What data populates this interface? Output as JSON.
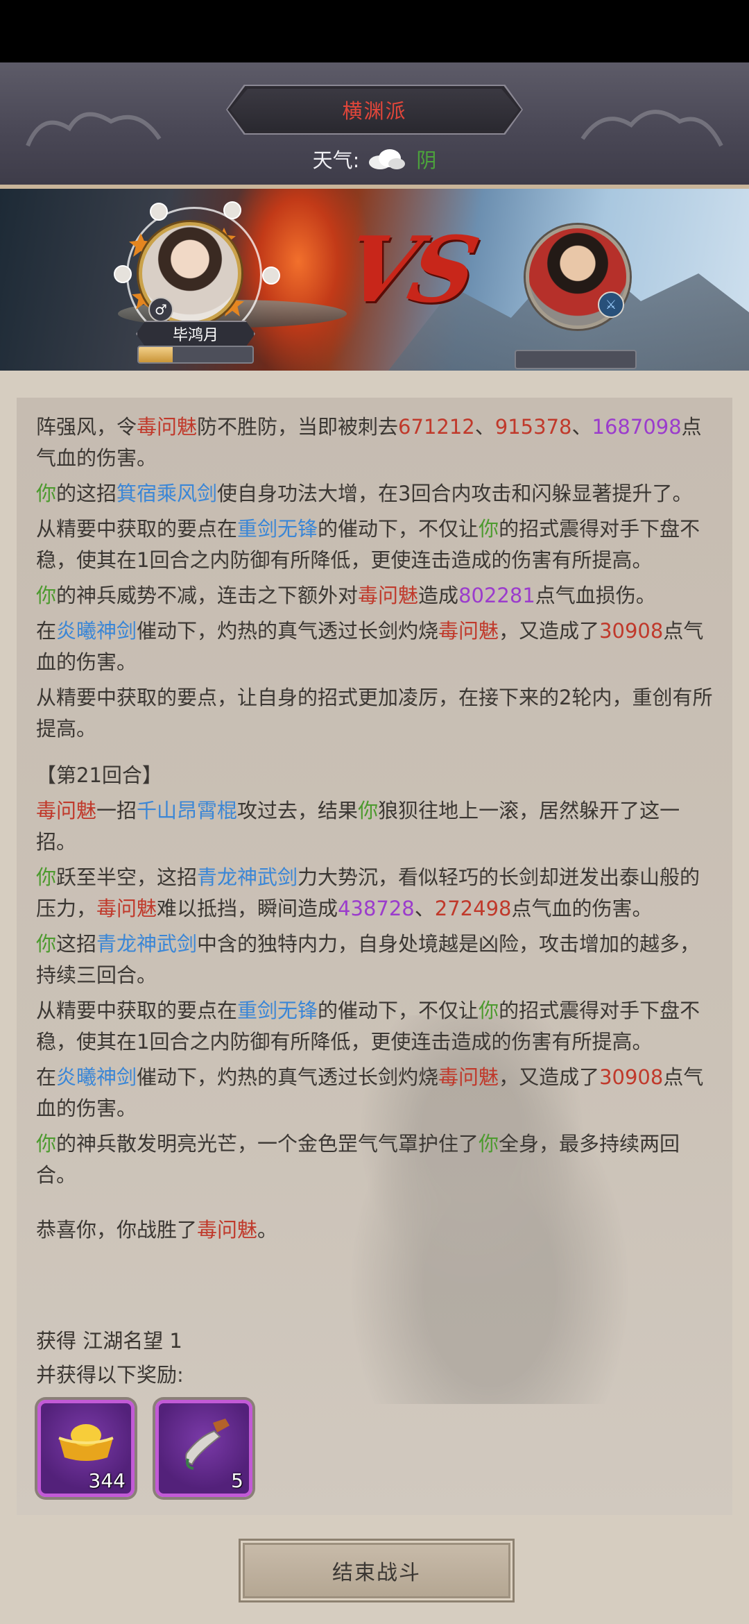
{
  "header": {
    "sect_title": "横渊派",
    "weather_label": "天气:",
    "weather_value": "阴"
  },
  "battle": {
    "player_name": "毕鸿月",
    "player_hp_fraction": 0.3,
    "enemy_hp_fraction": 0.0,
    "vs_text": "VS"
  },
  "log": {
    "entries": [
      [
        {
          "t": "阵强风，令",
          "c": "dark"
        },
        {
          "t": "毒问魅",
          "c": "red"
        },
        {
          "t": "防不胜防，当即被刺去",
          "c": "dark"
        },
        {
          "t": "671212",
          "c": "red"
        },
        {
          "t": "、",
          "c": "dark"
        },
        {
          "t": "915378",
          "c": "red"
        },
        {
          "t": "、",
          "c": "dark"
        },
        {
          "t": "1687098",
          "c": "purple"
        },
        {
          "t": "点气血的伤害。",
          "c": "dark"
        }
      ],
      [
        {
          "t": "你",
          "c": "green"
        },
        {
          "t": "的这招",
          "c": "dark"
        },
        {
          "t": "箕宿乘风剑",
          "c": "blue"
        },
        {
          "t": "使自身功法大增，在3回合内攻击和闪躲显著提升了。",
          "c": "dark"
        }
      ],
      [
        {
          "t": "从精要中获取的要点在",
          "c": "dark"
        },
        {
          "t": "重剑无锋",
          "c": "blue"
        },
        {
          "t": "的催动下，不仅让",
          "c": "dark"
        },
        {
          "t": "你",
          "c": "green"
        },
        {
          "t": "的招式震得对手下盘不稳，使其在1回合之内防御有所降低，更使连击造成的伤害有所提高。",
          "c": "dark"
        }
      ],
      [
        {
          "t": "你",
          "c": "green"
        },
        {
          "t": "的神兵威势不减，连击之下额外对",
          "c": "dark"
        },
        {
          "t": "毒问魅",
          "c": "red"
        },
        {
          "t": "造成",
          "c": "dark"
        },
        {
          "t": "802281",
          "c": "purple"
        },
        {
          "t": "点气血损伤。",
          "c": "dark"
        }
      ],
      [
        {
          "t": "在",
          "c": "dark"
        },
        {
          "t": "炎曦神剑",
          "c": "blue"
        },
        {
          "t": "催动下，灼热的真气透过长剑灼烧",
          "c": "dark"
        },
        {
          "t": "毒问魅",
          "c": "red"
        },
        {
          "t": "，又造成了",
          "c": "dark"
        },
        {
          "t": "30908",
          "c": "red"
        },
        {
          "t": "点气血的伤害。",
          "c": "dark"
        }
      ],
      [
        {
          "t": "从精要中获取的要点，让自身的招式更加凌厉，在接下来的2轮内，重创有所提高。",
          "c": "dark"
        }
      ]
    ],
    "round_label": "【第21回合】",
    "round_entries": [
      [
        {
          "t": "毒问魅",
          "c": "red"
        },
        {
          "t": "一招",
          "c": "dark"
        },
        {
          "t": "千山昂霄棍",
          "c": "blue"
        },
        {
          "t": "攻过去，结果",
          "c": "dark"
        },
        {
          "t": "你",
          "c": "green"
        },
        {
          "t": "狼狈往地上一滚，居然躲开了这一招。",
          "c": "dark"
        }
      ],
      [
        {
          "t": "你",
          "c": "green"
        },
        {
          "t": "跃至半空，这招",
          "c": "dark"
        },
        {
          "t": "青龙神武剑",
          "c": "blue"
        },
        {
          "t": "力大势沉，看似轻巧的长剑却迸发出泰山般的压力，",
          "c": "dark"
        },
        {
          "t": "毒问魅",
          "c": "red"
        },
        {
          "t": "难以抵挡，瞬间造成",
          "c": "dark"
        },
        {
          "t": "438728",
          "c": "purple"
        },
        {
          "t": "、",
          "c": "dark"
        },
        {
          "t": "272498",
          "c": "red"
        },
        {
          "t": "点气血的伤害。",
          "c": "dark"
        }
      ],
      [
        {
          "t": "你",
          "c": "green"
        },
        {
          "t": "这招",
          "c": "dark"
        },
        {
          "t": "青龙神武剑",
          "c": "blue"
        },
        {
          "t": "中含的独特内力，自身处境越是凶险，攻击增加的越多，持续三回合。",
          "c": "dark"
        }
      ],
      [
        {
          "t": "从精要中获取的要点在",
          "c": "dark"
        },
        {
          "t": "重剑无锋",
          "c": "blue"
        },
        {
          "t": "的催动下，不仅让",
          "c": "dark"
        },
        {
          "t": "你",
          "c": "green"
        },
        {
          "t": "的招式震得对手下盘不稳，使其在1回合之内防御有所降低，更使连击造成的伤害有所提高。",
          "c": "dark"
        }
      ],
      [
        {
          "t": "在",
          "c": "dark"
        },
        {
          "t": "炎曦神剑",
          "c": "blue"
        },
        {
          "t": "催动下，灼热的真气透过长剑灼烧",
          "c": "dark"
        },
        {
          "t": "毒问魅",
          "c": "red"
        },
        {
          "t": "，又造成了",
          "c": "dark"
        },
        {
          "t": "30908",
          "c": "red"
        },
        {
          "t": "点气血的伤害。",
          "c": "dark"
        }
      ],
      [
        {
          "t": "你",
          "c": "green"
        },
        {
          "t": "的神兵散发明亮光芒，一个金色罡气气罩护住了",
          "c": "dark"
        },
        {
          "t": "你",
          "c": "green"
        },
        {
          "t": "全身，最多持续两回合。",
          "c": "dark"
        }
      ]
    ],
    "victory": [
      {
        "t": "恭喜你，你战胜了",
        "c": "dark"
      },
      {
        "t": "毒问魅",
        "c": "red"
      },
      {
        "t": "。",
        "c": "dark"
      }
    ]
  },
  "rewards": {
    "reputation_label": "获得 江湖名望 1",
    "intro": "并获得以下奖励:",
    "items": [
      {
        "icon": "gold-ingot-icon",
        "count": "344"
      },
      {
        "icon": "dagger-icon",
        "count": "5"
      }
    ]
  },
  "end_button_label": "结束战斗",
  "colors": {
    "red": "#c0392b",
    "blue": "#3a86d6",
    "green": "#4c9a2e",
    "purple": "#9b3ccc",
    "dark": "#3b3733"
  }
}
